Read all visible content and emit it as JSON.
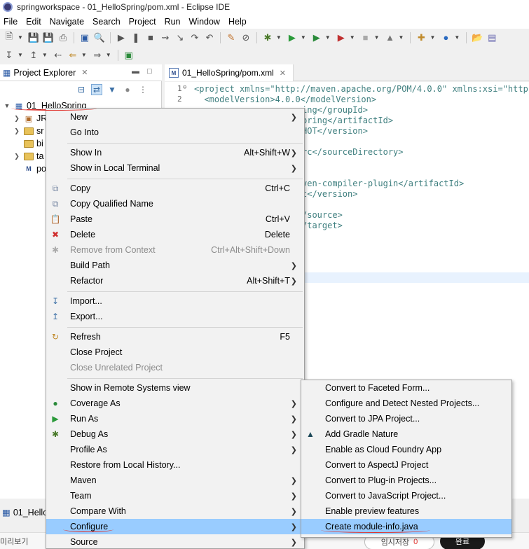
{
  "window": {
    "title": "springworkspace - 01_HelloSpring/pom.xml - Eclipse IDE"
  },
  "menubar": [
    "File",
    "Edit",
    "Navigate",
    "Search",
    "Project",
    "Run",
    "Window",
    "Help"
  ],
  "project_explorer": {
    "tab_label": "Project Explorer",
    "project": "01_HelloSpring",
    "children": [
      "JR",
      "sr",
      "bi",
      "ta",
      "po"
    ]
  },
  "editor": {
    "tab_label": "01_HelloSpring/pom.xml",
    "line_numbers": [
      "1",
      "2"
    ],
    "lines": [
      "<project xmlns=\"http://maven.apache.org/POM/4.0.0\" xmlns:xsi=\"http:/",
      "  <modelVersion>4.0.0</modelVersion>",
      "ing</groupId>",
      "pring</artifactId>",
      "HOT</version>",
      "",
      "rc</sourceDirectory>",
      "",
      "",
      "ven-compiler-plugin</artifactId>",
      "t</version>",
      "",
      "/source>",
      "/target>",
      "",
      ""
    ]
  },
  "bottom": {
    "tab_label": "01_Hello",
    "korean_left": "미리보기",
    "korean_save": "임시저장",
    "korean_save_count": "0",
    "korean_done": "완료"
  },
  "context_menu": {
    "items": [
      {
        "label": "New",
        "shortcut": "",
        "submenu": true
      },
      {
        "label": "Go Into",
        "shortcut": "",
        "submenu": false
      },
      {
        "label": "Show In",
        "shortcut": "Alt+Shift+W",
        "submenu": true
      },
      {
        "label": "Show in Local Terminal",
        "shortcut": "",
        "submenu": true
      },
      {
        "label": "Copy",
        "shortcut": "Ctrl+C",
        "submenu": false
      },
      {
        "label": "Copy Qualified Name",
        "shortcut": "",
        "submenu": false
      },
      {
        "label": "Paste",
        "shortcut": "Ctrl+V",
        "submenu": false
      },
      {
        "label": "Delete",
        "shortcut": "Delete",
        "submenu": false
      },
      {
        "label": "Remove from Context",
        "shortcut": "Ctrl+Alt+Shift+Down",
        "submenu": false
      },
      {
        "label": "Build Path",
        "shortcut": "",
        "submenu": true
      },
      {
        "label": "Refactor",
        "shortcut": "Alt+Shift+T",
        "submenu": true
      },
      {
        "label": "Import...",
        "shortcut": "",
        "submenu": false
      },
      {
        "label": "Export...",
        "shortcut": "",
        "submenu": false
      },
      {
        "label": "Refresh",
        "shortcut": "F5",
        "submenu": false
      },
      {
        "label": "Close Project",
        "shortcut": "",
        "submenu": false
      },
      {
        "label": "Close Unrelated Project",
        "shortcut": "",
        "submenu": false
      },
      {
        "label": "Show in Remote Systems view",
        "shortcut": "",
        "submenu": false
      },
      {
        "label": "Coverage As",
        "shortcut": "",
        "submenu": true
      },
      {
        "label": "Run As",
        "shortcut": "",
        "submenu": true
      },
      {
        "label": "Debug As",
        "shortcut": "",
        "submenu": true
      },
      {
        "label": "Profile As",
        "shortcut": "",
        "submenu": true
      },
      {
        "label": "Restore from Local History...",
        "shortcut": "",
        "submenu": false
      },
      {
        "label": "Maven",
        "shortcut": "",
        "submenu": true
      },
      {
        "label": "Team",
        "shortcut": "",
        "submenu": true
      },
      {
        "label": "Compare With",
        "shortcut": "",
        "submenu": true
      },
      {
        "label": "Configure",
        "shortcut": "",
        "submenu": true
      },
      {
        "label": "Source",
        "shortcut": "",
        "submenu": true
      }
    ]
  },
  "configure_submenu": {
    "items": [
      "Convert to Faceted Form...",
      "Configure and Detect Nested Projects...",
      "Convert to JPA Project...",
      "Add Gradle Nature",
      "Enable as Cloud Foundry App",
      "Convert to AspectJ Project",
      "Convert to Plug-in Projects...",
      "Convert to JavaScript Project...",
      "Enable preview features",
      "Create module-info.java"
    ]
  },
  "colors": {
    "highlight": "#99ccff",
    "annotation_red": "#e0302a"
  }
}
